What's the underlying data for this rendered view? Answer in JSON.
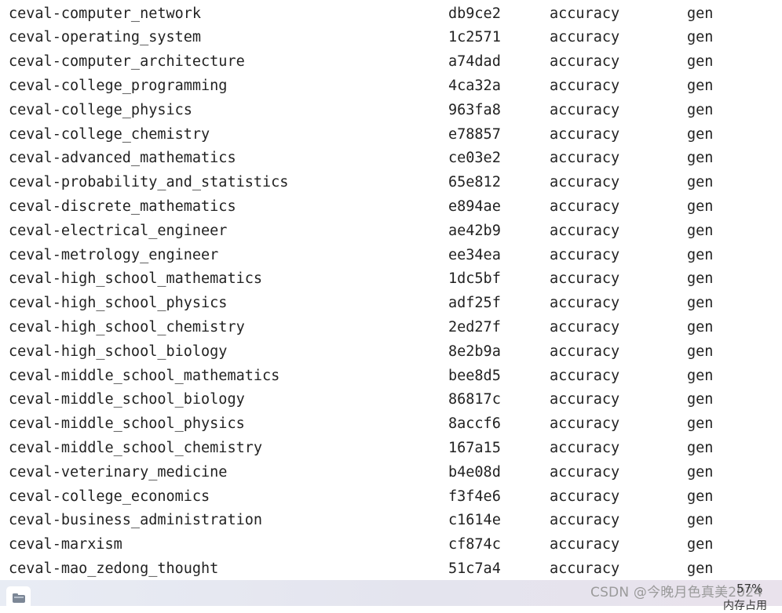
{
  "rows": [
    {
      "name": "ceval-computer_network",
      "version": "db9ce2",
      "metric": "accuracy",
      "mode": "gen"
    },
    {
      "name": "ceval-operating_system",
      "version": "1c2571",
      "metric": "accuracy",
      "mode": "gen"
    },
    {
      "name": "ceval-computer_architecture",
      "version": "a74dad",
      "metric": "accuracy",
      "mode": "gen"
    },
    {
      "name": "ceval-college_programming",
      "version": "4ca32a",
      "metric": "accuracy",
      "mode": "gen"
    },
    {
      "name": "ceval-college_physics",
      "version": "963fa8",
      "metric": "accuracy",
      "mode": "gen"
    },
    {
      "name": "ceval-college_chemistry",
      "version": "e78857",
      "metric": "accuracy",
      "mode": "gen"
    },
    {
      "name": "ceval-advanced_mathematics",
      "version": "ce03e2",
      "metric": "accuracy",
      "mode": "gen"
    },
    {
      "name": "ceval-probability_and_statistics",
      "version": "65e812",
      "metric": "accuracy",
      "mode": "gen"
    },
    {
      "name": "ceval-discrete_mathematics",
      "version": "e894ae",
      "metric": "accuracy",
      "mode": "gen"
    },
    {
      "name": "ceval-electrical_engineer",
      "version": "ae42b9",
      "metric": "accuracy",
      "mode": "gen"
    },
    {
      "name": "ceval-metrology_engineer",
      "version": "ee34ea",
      "metric": "accuracy",
      "mode": "gen"
    },
    {
      "name": "ceval-high_school_mathematics",
      "version": "1dc5bf",
      "metric": "accuracy",
      "mode": "gen"
    },
    {
      "name": "ceval-high_school_physics",
      "version": "adf25f",
      "metric": "accuracy",
      "mode": "gen"
    },
    {
      "name": "ceval-high_school_chemistry",
      "version": "2ed27f",
      "metric": "accuracy",
      "mode": "gen"
    },
    {
      "name": "ceval-high_school_biology",
      "version": "8e2b9a",
      "metric": "accuracy",
      "mode": "gen"
    },
    {
      "name": "ceval-middle_school_mathematics",
      "version": "bee8d5",
      "metric": "accuracy",
      "mode": "gen"
    },
    {
      "name": "ceval-middle_school_biology",
      "version": "86817c",
      "metric": "accuracy",
      "mode": "gen"
    },
    {
      "name": "ceval-middle_school_physics",
      "version": "8accf6",
      "metric": "accuracy",
      "mode": "gen"
    },
    {
      "name": "ceval-middle_school_chemistry",
      "version": "167a15",
      "metric": "accuracy",
      "mode": "gen"
    },
    {
      "name": "ceval-veterinary_medicine",
      "version": "b4e08d",
      "metric": "accuracy",
      "mode": "gen"
    },
    {
      "name": "ceval-college_economics",
      "version": "f3f4e6",
      "metric": "accuracy",
      "mode": "gen"
    },
    {
      "name": "ceval-business_administration",
      "version": "c1614e",
      "metric": "accuracy",
      "mode": "gen"
    },
    {
      "name": "ceval-marxism",
      "version": "cf874c",
      "metric": "accuracy",
      "mode": "gen"
    },
    {
      "name": "ceval-mao_zedong_thought",
      "version": "51c7a4",
      "metric": "accuracy",
      "mode": "gen"
    }
  ],
  "taskbar": {
    "app_icon": "cloud-app-icon",
    "watermark": "CSDN @今晚月色真美2024",
    "cpu_percent": "57%",
    "cpu_label": "内存占用"
  }
}
